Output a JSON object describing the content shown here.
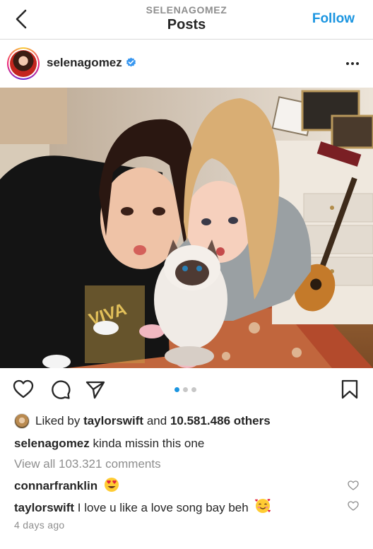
{
  "header": {
    "username": "SELENAGOMEZ",
    "title": "Posts",
    "follow_label": "Follow"
  },
  "post": {
    "username": "selenagomez",
    "verified": true,
    "more_icon": "more-horizontal-icon",
    "image_description_icon": "photo",
    "carousel": {
      "total": 3,
      "active": 1
    },
    "likes": {
      "prefix": "Liked by",
      "user": "taylorswift",
      "and": "and",
      "count": "10.581.486 others"
    },
    "caption": {
      "user": "selenagomez",
      "text": "kinda missin this one"
    },
    "view_comments": "View all 103.321 comments",
    "comments": [
      {
        "user": "connarfranklin",
        "text": "",
        "emoji": "heart-eyes-emoji"
      },
      {
        "user": "taylorswift",
        "text": "I love u like a love song bay beh",
        "emoji": "smiling-face-with-hearts-emoji"
      }
    ],
    "time_ago": "4 days ago"
  },
  "colors": {
    "accent": "#1b95e0",
    "text": "#262626",
    "muted": "#8e8e8e"
  }
}
